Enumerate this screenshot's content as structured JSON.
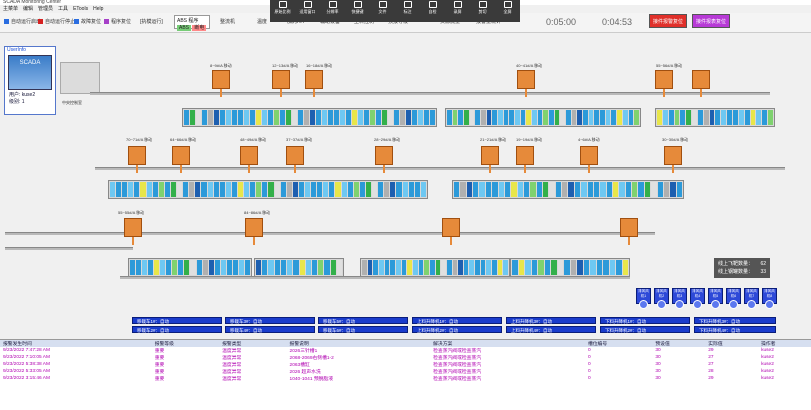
{
  "window": {
    "title": "SCADA Monitoring Center"
  },
  "menu": [
    "主菜单",
    "编辑",
    "管理员",
    "工具",
    "ETools",
    "Help"
  ],
  "toolbar": {
    "auto_run": "自动运行启动",
    "auto_stop": "自动运行停止",
    "fault_reset": "故障复位",
    "pos_reset": "程序复位",
    "mode_label": "[执模运行]",
    "abs_title": "ABS 程序",
    "abs_a": "ABS",
    "abs_b": "断电",
    "wholeplant": "整流机",
    "temp": "温度",
    "ai_heat": "加药AH",
    "aux": "辅助设备",
    "upload": "上料控制",
    "alarm_level": "预报等级",
    "consumables": "资源流量",
    "alarm_report": "报警量统计"
  },
  "overlay": {
    "items": [
      "原始比例",
      "适用窗口",
      "分辨率",
      "快捷键",
      "文件",
      "标注",
      "自检",
      "录屏",
      "剪切",
      "全屏"
    ]
  },
  "timers": {
    "t1": "0:05:00",
    "t2": "0:04:53"
  },
  "alarm_buttons": {
    "b1": "接件报警复位",
    "b2": "接件报表复位"
  },
  "userinfo": {
    "header": "UserInfo",
    "logo": "SCADA",
    "user": "用户: kuse2",
    "level": "级别: 1"
  },
  "storage": {
    "label": "中央控制室"
  },
  "crane_labels": [
    "8~9#/A 移动",
    "12~13#/A 移动",
    "16~18#/A 移动",
    "40~41#/A 移动",
    "55~56#/A 移动",
    "70~71#/A 移动",
    "64~66#/A 移动",
    "48~49#/A 移动",
    "37~37#/A 移动",
    "28~29#/A 移动",
    "21~21#/A 移动",
    "19~19#/A 移动",
    "4~6#/A 移动",
    "30~30#/A 移动",
    "55~55#/A 移动",
    "84~86#/A 移动"
  ],
  "status_rows": [
    {
      "text": "移栽车1#：自动"
    },
    {
      "text": "移栽车3#：自动"
    },
    {
      "text": "移栽车5#：自动"
    },
    {
      "text": "上料升降机1#：自动"
    },
    {
      "text": "上料升降机3#：自动"
    },
    {
      "text": "下料升降机1#：自动"
    },
    {
      "text": "下料升降机3#：自动"
    },
    {
      "text": "移栽车2#：自动"
    },
    {
      "text": "移栽车4#：自动"
    },
    {
      "text": "移栽车6#：自动"
    },
    {
      "text": "上料升降机2#：自动"
    },
    {
      "text": "上料升降机4#：自动"
    },
    {
      "text": "下料升降机2#：自动"
    },
    {
      "text": "下料升降机4#：自动"
    }
  ],
  "flight": {
    "l1": "线上飞靶数量：",
    "v1": "62",
    "l2": "线上钢罐数量：",
    "v2": "33"
  },
  "fans": [
    "排风风机1",
    "排风风机2",
    "排风风机3",
    "排风风机4",
    "排风风机5",
    "排风风机6",
    "排风风机7",
    "排风风机8"
  ],
  "alarm_table": {
    "headers": [
      "报警发生时间",
      "报警等级",
      "报警类型",
      "报警说明",
      "解决方案",
      "槽位编号",
      "预设值",
      "实际值",
      "操作者"
    ],
    "rows": [
      [
        "9/23/2022 7:47:28 AM",
        "重要",
        "温度异常",
        "2026三针槽1",
        "检查蒸汽阀或检查蒸汽",
        "0",
        "30",
        "29",
        "kuse2"
      ],
      [
        "9/23/2022 7:10:05 AM",
        "重要",
        "温度异常",
        "2068-2069右侧槽1-2",
        "检查蒸汽阀或检查蒸汽",
        "0",
        "30",
        "27",
        "kuse2"
      ],
      [
        "9/23/2022 5:38:38 AM",
        "重要",
        "温度异常",
        "2063槽缸",
        "检查蒸汽阀或检查蒸汽",
        "0",
        "30",
        "27",
        "kuse2"
      ],
      [
        "9/23/2022 5:33:05 AM",
        "重要",
        "温度异常",
        "2026    超声水洗",
        "检查蒸汽阀或检查蒸汽",
        "0",
        "30",
        "28",
        "kuse2"
      ],
      [
        "9/23/2022 3:15:46 AM",
        "重要",
        "温度异常",
        "1040-1041       预脱脂液",
        "检查蒸汽阀或检查蒸汽",
        "0",
        "30",
        "29",
        "kuse2"
      ]
    ]
  },
  "colors": {
    "crane": "#e68a3a",
    "status_blue": "#1a3ccc",
    "alarm_text": "#b000b0",
    "alarm_red": "#e0302a",
    "alarm_purple": "#b73ad6"
  }
}
